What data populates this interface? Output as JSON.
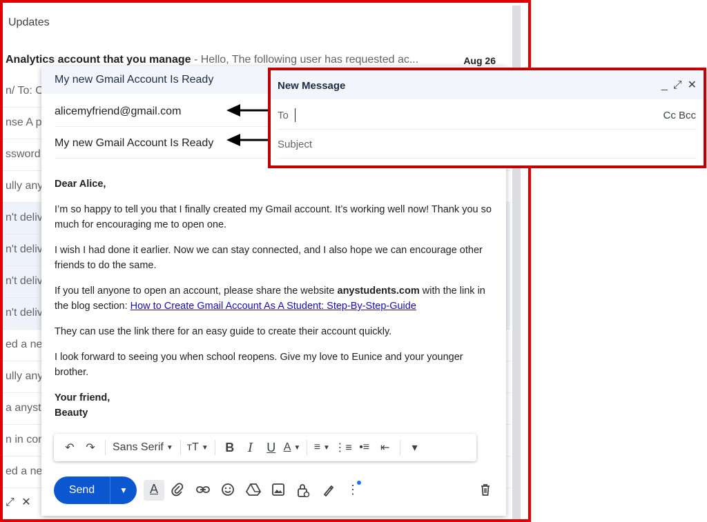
{
  "inbox": {
    "section_title": "Updates",
    "first_row": {
      "sender": "Analytics account that you manage",
      "snippet": " - Hello, The following user has requested ac...",
      "date": "Aug 26"
    },
    "row_fragments": [
      "n/ To: O",
      "nse A pa",
      "ssword f",
      "ully anys",
      "n't deliv",
      "n't deliv",
      "n't deliv",
      "n't deliv",
      "ed a new",
      "ully anys",
      "a anystu",
      "n in cont",
      "ed a new"
    ],
    "bottom_icons": [
      "expand-icon",
      "close-icon"
    ]
  },
  "compose": {
    "title": "My new Gmail Account Is Ready",
    "to": "alicemyfriend@gmail.com",
    "subject": "My new Gmail Account Is Ready",
    "body": {
      "greeting": "Dear Alice,",
      "p1": "I’m so happy to tell you that I finally created my Gmail account. It’s working well now! Thank you so much for encouraging me to open one.",
      "p2": "I wish I had done it earlier. Now we can stay connected, and I also hope we can encourage other friends to do the same.",
      "p3_start": "If you tell anyone to open an account, please share the website ",
      "p3_site": "anystudents.com",
      "p3_mid": " with the link in the blog section: ",
      "p3_link": "How to Create Gmail Account As A Student: Step-By-Step-Guide",
      "p4": "They can use the link  there for an easy guide to create their account quickly.",
      "p5": "I look forward to seeing you when school reopens. Give my love to Eunice and your younger brother.",
      "closing": "Your friend,",
      "signature": "Beauty"
    },
    "toolbar": {
      "undo": "↶",
      "redo": "↷",
      "font_family": "Sans Serif",
      "font_size": "ᴛT",
      "bold": "B",
      "italic": "I",
      "underline": "U",
      "text_color": "A",
      "align": "≡",
      "numbered_list": "⋮≡",
      "bulleted_list": "•≡",
      "indent_less": "⇤",
      "more": "▾"
    },
    "send_label": "Send"
  },
  "new_message": {
    "title": "New Message",
    "to_label": "To",
    "cc_bcc": "Cc Bcc",
    "subject_placeholder": "Subject"
  },
  "colors": {
    "frame_red": "#e00000",
    "box_red": "#c00000",
    "send_blue": "#0b57d0",
    "link_blue": "#1a0dab"
  }
}
